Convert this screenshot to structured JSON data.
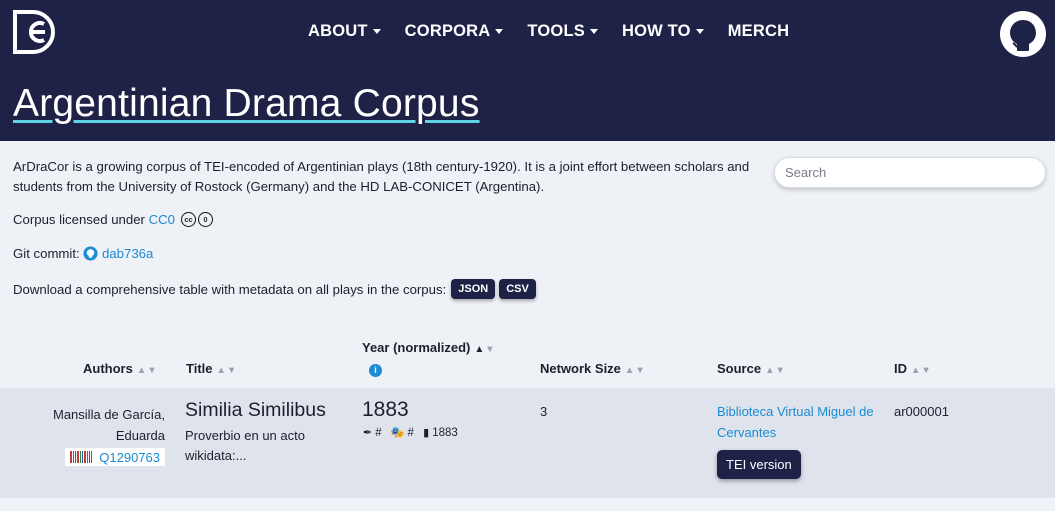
{
  "nav": {
    "items": [
      {
        "label": "ABOUT",
        "dropdown": true
      },
      {
        "label": "CORPORA",
        "dropdown": true
      },
      {
        "label": "TOOLS",
        "dropdown": true
      },
      {
        "label": "HOW TO",
        "dropdown": true
      },
      {
        "label": "MERCH",
        "dropdown": false
      }
    ],
    "logo_icon": "dracor-logo-icon",
    "github_icon": "github-icon"
  },
  "page": {
    "title": "Argentinian Drama Corpus",
    "description": "ArDraCor is a growing corpus of TEI-encoded of Argentinian plays (18th century-1920). It is a joint effort between scholars and students from the University of Rostock (Germany) and the HD LAB-CONICET (Argentina).",
    "license_prefix": "Corpus licensed under",
    "license_link": "CC0",
    "git_prefix": "Git commit:",
    "git_commit": "dab736a",
    "download_text": "Download a comprehensive table with metadata on all plays in the corpus:",
    "download_json": "JSON",
    "download_csv": "CSV"
  },
  "search": {
    "placeholder": "Search"
  },
  "table": {
    "headers": {
      "authors": "Authors",
      "title": "Title",
      "year": "Year (normalized)",
      "network": "Network Size",
      "source": "Source",
      "id": "ID"
    },
    "rows": [
      {
        "author_line1": "Mansilla de García,",
        "author_line2": "Eduarda",
        "wikidata": "Q1290763",
        "title": "Similia Similibus",
        "subtitle_line1": "Proverbio en un acto",
        "subtitle_line2": "wikidata:...",
        "year": "1883",
        "written": "#",
        "premiered": "#",
        "printed": "1883",
        "network_size": "3",
        "source": "Biblioteca Virtual Miguel de Cervantes",
        "tei_label": "TEI version",
        "id": "ar000001"
      }
    ]
  },
  "colors": {
    "header_bg": "#1f2247",
    "accent_link": "#1a8bd4",
    "title_underline": "#5fd2e4",
    "page_bg": "#eef1f6",
    "row_bg": "#dfe3ec"
  }
}
